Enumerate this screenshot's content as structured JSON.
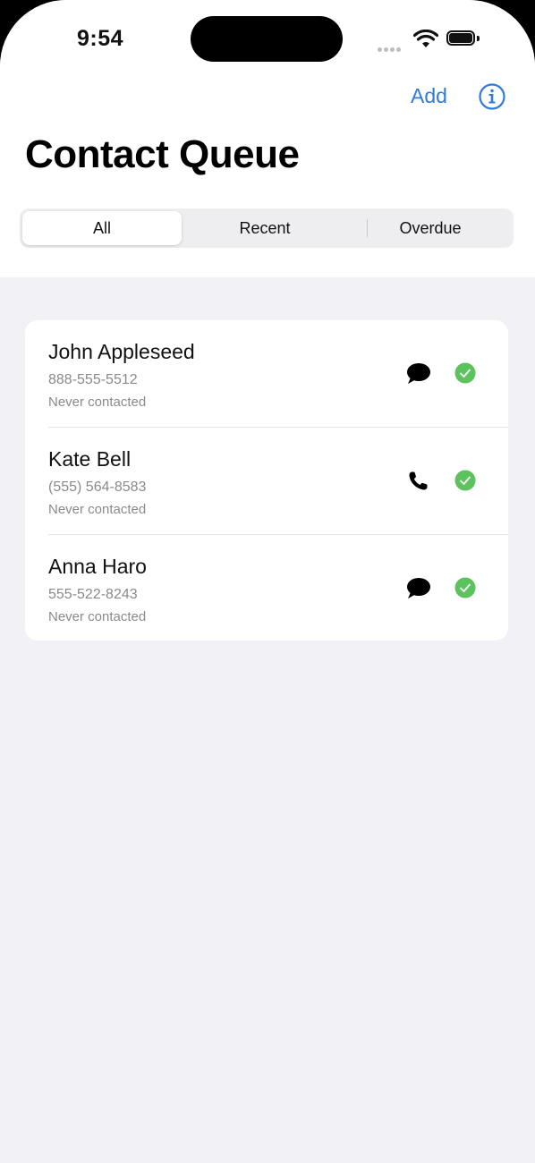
{
  "status_bar": {
    "time": "9:54"
  },
  "nav": {
    "add_label": "Add",
    "info_icon": "info-circle-icon",
    "accent_color": "#2f7bd8"
  },
  "page": {
    "title": "Contact Queue"
  },
  "segments": [
    {
      "label": "All",
      "selected": true
    },
    {
      "label": "Recent",
      "selected": false
    },
    {
      "label": "Overdue",
      "selected": false
    }
  ],
  "contacts": [
    {
      "name": "John Appleseed",
      "phone": "888-555-5512",
      "status": "Never contacted",
      "method_icon": "message-bubble-icon"
    },
    {
      "name": "Kate Bell",
      "phone": "(555) 564-8583",
      "status": "Never contacted",
      "method_icon": "phone-icon"
    },
    {
      "name": "Anna Haro",
      "phone": "555-522-8243",
      "status": "Never contacted",
      "method_icon": "message-bubble-icon"
    }
  ],
  "colors": {
    "check_green": "#5bc25c",
    "background": "#f1f1f6"
  }
}
